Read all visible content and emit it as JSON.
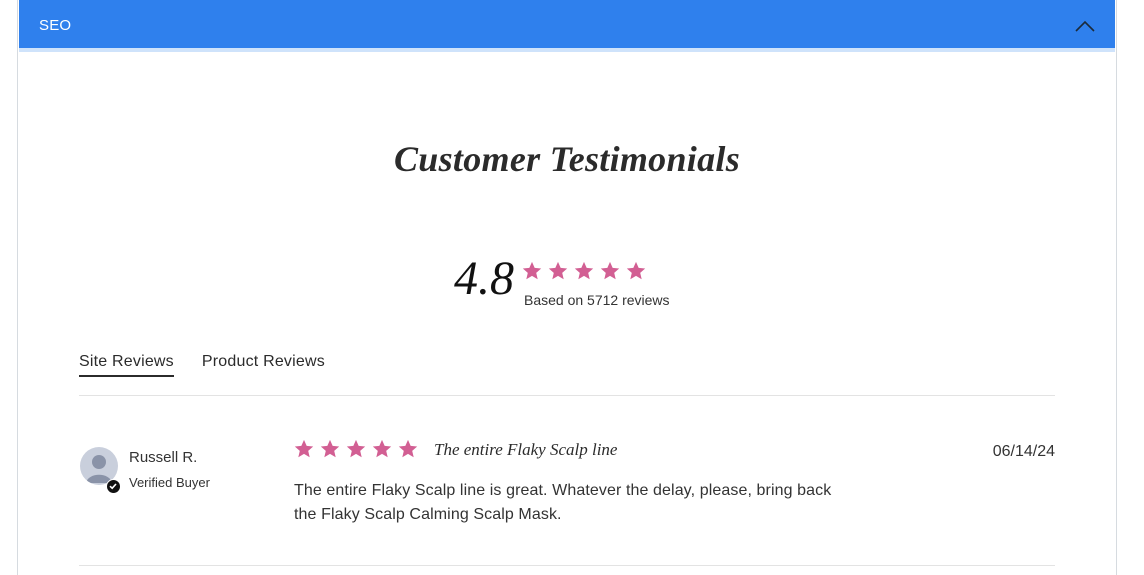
{
  "accordion": {
    "title": "SEO",
    "toggle_icon": "chevron-up-icon",
    "color": "#2f80ed"
  },
  "section": {
    "heading": "Customer Testimonials"
  },
  "summary": {
    "rating": "4.8",
    "stars": 5,
    "star_color": "#d25f93",
    "count_text": "Based on 5712 reviews"
  },
  "tabs": [
    {
      "label": "Site Reviews",
      "active": true
    },
    {
      "label": "Product Reviews",
      "active": false
    }
  ],
  "reviews": [
    {
      "author": "Russell R.",
      "status": "Verified Buyer",
      "rating": 5,
      "title": "The entire Flaky Scalp line",
      "date": "06/14/24",
      "body": "The entire Flaky Scalp line is great. Whatever the delay, please, bring back the Flaky Scalp Calming Scalp Mask."
    }
  ]
}
